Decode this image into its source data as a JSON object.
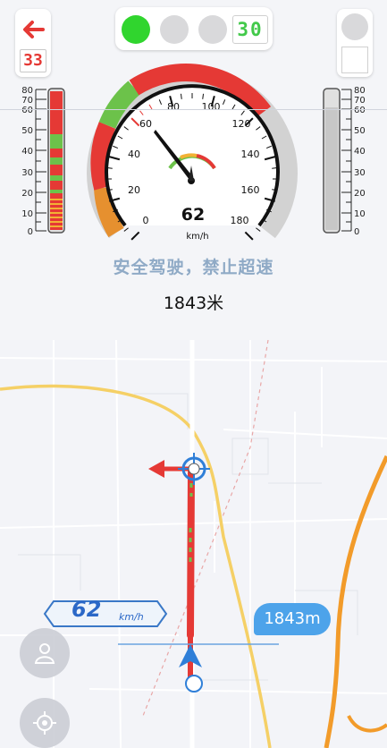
{
  "traffic": {
    "countdown": "30",
    "active_light": "green",
    "colors": {
      "green": "#30d52e",
      "off": "#d9d9db"
    }
  },
  "left_panel": {
    "back_icon": "arrow-left-icon",
    "counter": "33"
  },
  "bars": {
    "scale_ticks": [
      "80",
      "70",
      "60",
      "50",
      "40",
      "30",
      "20",
      "10",
      "0"
    ],
    "left_level": 1.0,
    "right_level": 0.88
  },
  "speedometer": {
    "speed": "62",
    "unit": "km/h",
    "speed_value": 62,
    "max": 180,
    "tick_labels": [
      "0",
      "20",
      "40",
      "60",
      "80",
      "100",
      "120",
      "140",
      "160",
      "180"
    ]
  },
  "status": {
    "message": "安全驾驶，禁止超速",
    "distance": "1843米"
  },
  "map": {
    "speed_value": "62",
    "speed_unit": "km/h",
    "distance_badge": "1843m"
  },
  "buttons": {
    "profile_icon": "person-icon",
    "locate_icon": "locate-icon"
  }
}
